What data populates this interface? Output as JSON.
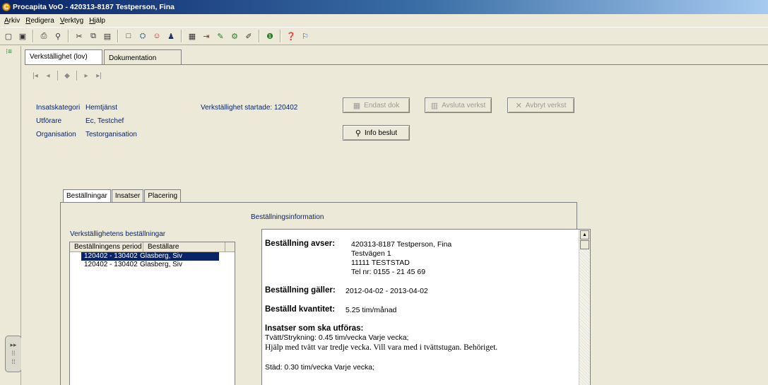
{
  "window": {
    "title": "Procapita VoO - 420313-8187 Testperson, Fina"
  },
  "menu": [
    {
      "key": "A",
      "rest": "rkiv"
    },
    {
      "key": "R",
      "rest": "edigera"
    },
    {
      "key": "V",
      "rest": "erktyg"
    },
    {
      "key": "H",
      "rest": "jälp"
    }
  ],
  "outer_tabs": [
    "Verkställighet (lov)",
    "Dokumentation"
  ],
  "details": {
    "insatskategori_label": "Insatskategori",
    "insatskategori_value": "Hemtjänst",
    "utforare_label": "Utförare",
    "utforare_value": "Ec, Testchef",
    "organisation_label": "Organisation",
    "organisation_value": "Testorganisation",
    "startad": "Verkställighet startade: 120402"
  },
  "buttons": {
    "endast_dok": "Endast dok",
    "avsluta": "Avsluta verkst",
    "avbryt": "Avbryt verkst",
    "info_beslut": "Info beslut"
  },
  "inner_tabs": [
    "Beställningar",
    "Insatser",
    "Placering"
  ],
  "orders": {
    "title": "Verkställighetens beställningar",
    "columns": [
      "Beställningens period",
      "Beställare"
    ],
    "rows": [
      {
        "period": "120402 - 130402",
        "orderer": "Glasberg, Siv",
        "selected": true
      },
      {
        "period": "120402 - 130402",
        "orderer": "Glasberg, Siv",
        "selected": false
      }
    ]
  },
  "info": {
    "title": "Beställningsinformation",
    "avser_label": "Beställning avser:",
    "avser_lines": [
      "420313-8187  Testperson, Fina",
      "Testvägen 1",
      "11111  TESTSTAD",
      "Tel nr: 0155 - 21 45 69"
    ],
    "galler_label": "Beställning gäller:",
    "galler_value": "2012-04-02 - 2013-04-02",
    "kvantitet_label": "Beställd kvantitet:",
    "kvantitet_value": "5.25 tim/månad",
    "insatser_label": "Insatser som ska utföras:",
    "insats1": "Tvätt/Strykning:  0.45 tim/vecka Varje vecka;",
    "insats1_note": "Hjälp med tvätt var tredje vecka. Vill vara med i tvättstugan. Behöriget.",
    "insats2": "Städ:  0.30 tim/vecka Varje vecka;"
  }
}
